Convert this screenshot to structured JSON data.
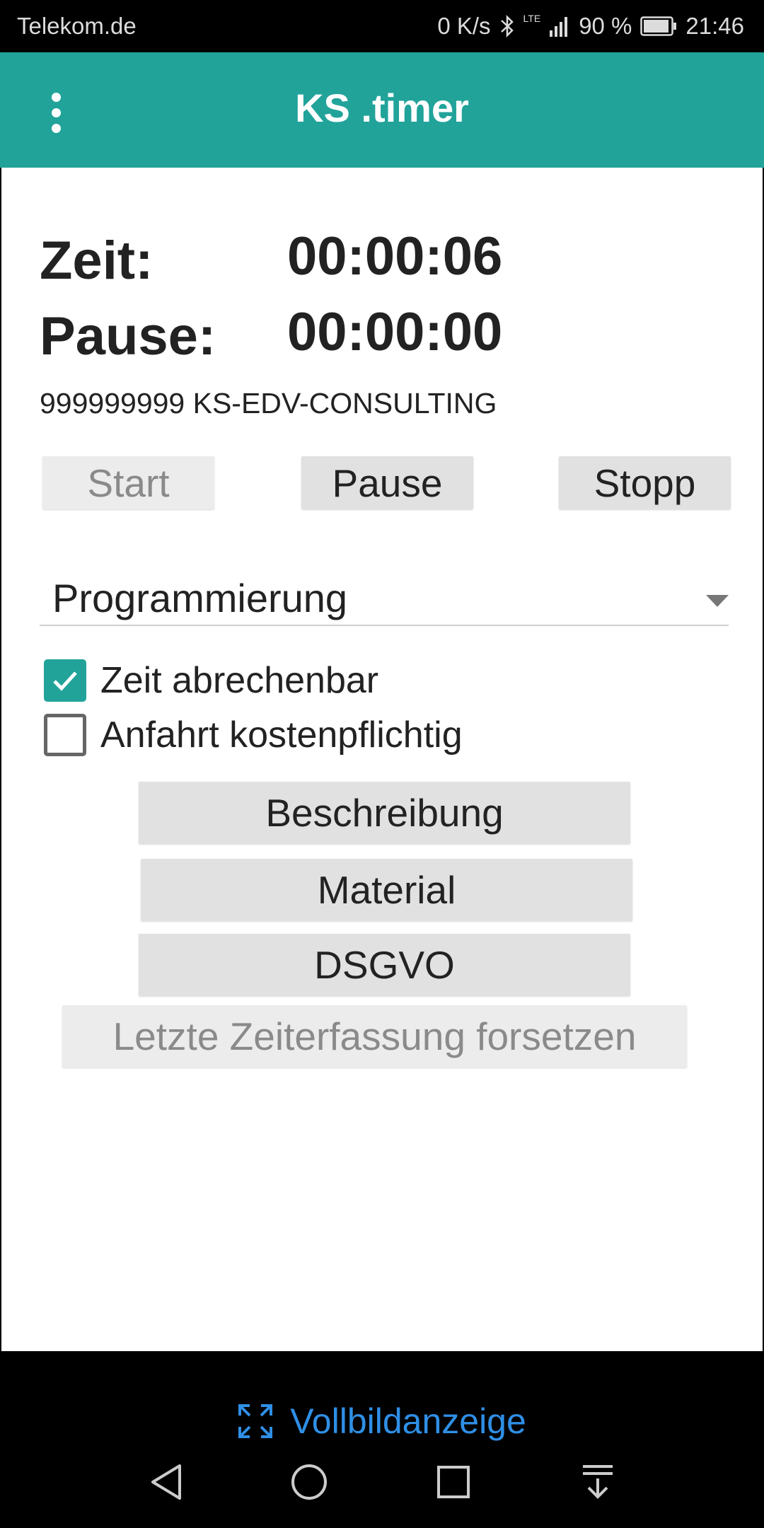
{
  "status_bar": {
    "carrier": "Telekom.de",
    "network_speed": "0 K/s",
    "lte": "LTE",
    "battery_percent": "90 %",
    "time": "21:46"
  },
  "app_bar": {
    "title": "KS .timer"
  },
  "timer": {
    "zeit_label": "Zeit:",
    "zeit_value": "00:00:06",
    "pause_label": "Pause:",
    "pause_value": "00:00:00"
  },
  "customer": "999999999 KS-EDV-CONSULTING",
  "controls": {
    "start": "Start",
    "pause": "Pause",
    "stopp": "Stopp"
  },
  "activity": {
    "selected": "Programmierung"
  },
  "checkboxes": {
    "zeit_abrechenbar": {
      "label": "Zeit abrechenbar",
      "checked": true
    },
    "anfahrt_kostenpflichtig": {
      "label": "Anfahrt kostenpflichtig",
      "checked": false
    }
  },
  "actions": {
    "beschreibung": "Beschreibung",
    "material": "Material",
    "dsgvo": "DSGVO",
    "letzte": "Letzte Zeiterfassung forsetzen"
  },
  "fullscreen_prompt": {
    "label": "Vollbildanzeige"
  },
  "colors": {
    "accent": "#21a39a",
    "link": "#2f8fe6"
  }
}
